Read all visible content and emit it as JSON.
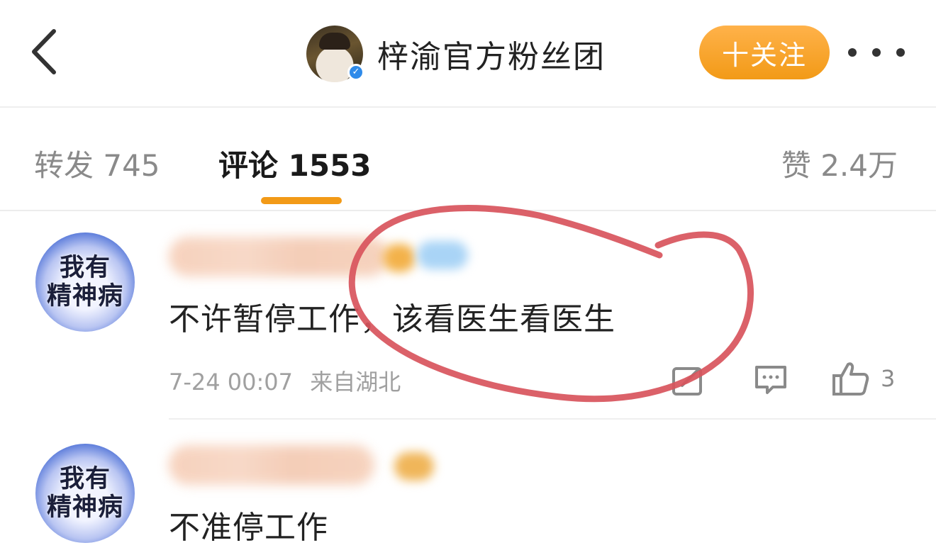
{
  "header": {
    "back_icon": "chevron-left-icon",
    "title": "梓渝官方粉丝团",
    "follow_label": "十关注",
    "more_icon": "more-horizontal-icon",
    "verified_icon": "verified-badge-icon"
  },
  "tabs": [
    {
      "label": "转发 745",
      "active": false
    },
    {
      "label": "评论 1553",
      "active": true
    },
    {
      "label": "赞 2.4万",
      "active": false
    }
  ],
  "comments": [
    {
      "avatar_text": [
        "我有",
        "精神病"
      ],
      "text": "不许暂停工作，该看医生看医生",
      "time": "7-24 00:07",
      "location": "来自湖北",
      "like_count": "3"
    },
    {
      "avatar_text": [
        "我有",
        "精神病"
      ],
      "text": "不准停工作"
    }
  ],
  "colors": {
    "accent": "#f29a17",
    "annotation": "#d8545c",
    "verified": "#2f8bea"
  }
}
